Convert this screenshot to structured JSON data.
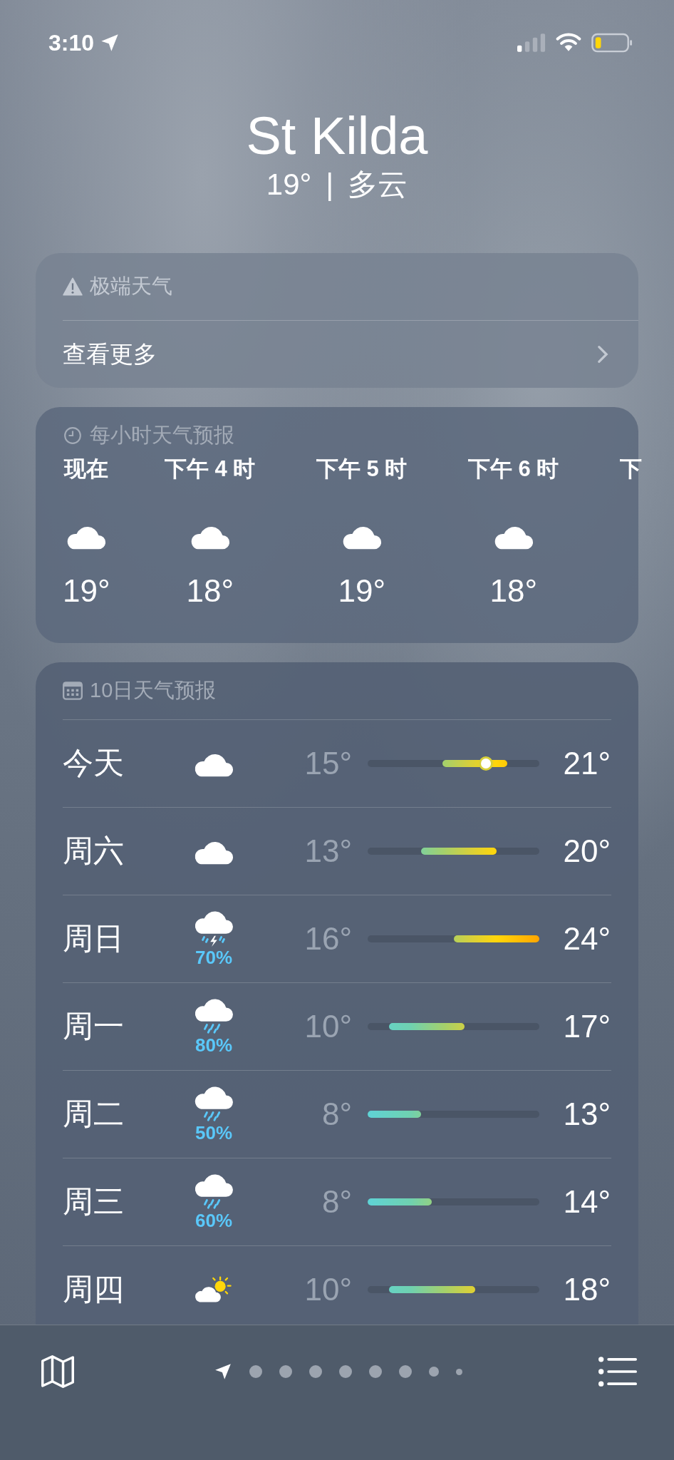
{
  "status_bar": {
    "time": "3:10"
  },
  "location": {
    "name": "St Kilda",
    "temperature": "19°",
    "separator": "|",
    "condition": "多云"
  },
  "alert_card": {
    "title": "极端天气",
    "link": "查看更多"
  },
  "hourly": {
    "title": "每小时天气预报",
    "items": [
      {
        "label": "现在",
        "kind": "cloud",
        "temperature": "19°"
      },
      {
        "label": "下午 4 时",
        "kind": "cloud",
        "temperature": "18°"
      },
      {
        "label": "下午 5 时",
        "kind": "cloud",
        "temperature": "19°"
      },
      {
        "label": "下午 6 时",
        "kind": "cloud",
        "temperature": "18°"
      },
      {
        "label": "下",
        "kind": "cut"
      }
    ]
  },
  "daily": {
    "title": "10日天气预报",
    "days": [
      {
        "day": "今天",
        "kind": "cloud",
        "low": "15°",
        "high": "21°",
        "today": true
      },
      {
        "day": "周六",
        "kind": "cloud",
        "low": "13°",
        "high": "20°",
        "today": false
      },
      {
        "day": "周日",
        "kind": "thunder",
        "precipitation": "70%",
        "low": "16°",
        "high": "24°",
        "today": false
      },
      {
        "day": "周一",
        "kind": "rain",
        "precipitation": "80%",
        "low": "10°",
        "high": "17°",
        "today": false
      },
      {
        "day": "周二",
        "kind": "rain",
        "precipitation": "50%",
        "low": "8°",
        "high": "13°",
        "today": false
      },
      {
        "day": "周三",
        "kind": "rain",
        "precipitation": "60%",
        "low": "8°",
        "high": "14°",
        "today": false
      },
      {
        "day": "周四",
        "kind": "partly_sunny",
        "low": "10°",
        "high": "18°",
        "today": false
      }
    ]
  },
  "pages": [
    {
      "kind": "location",
      "selected": true
    },
    {
      "kind": "dot",
      "selected": false
    },
    {
      "kind": "dot",
      "selected": false
    },
    {
      "kind": "dot",
      "selected": false
    },
    {
      "kind": "dot",
      "selected": false
    },
    {
      "kind": "dot",
      "selected": false
    },
    {
      "kind": "dot",
      "selected": false
    },
    {
      "kind": "small",
      "selected": false
    },
    {
      "kind": "tiny",
      "selected": false
    }
  ]
}
